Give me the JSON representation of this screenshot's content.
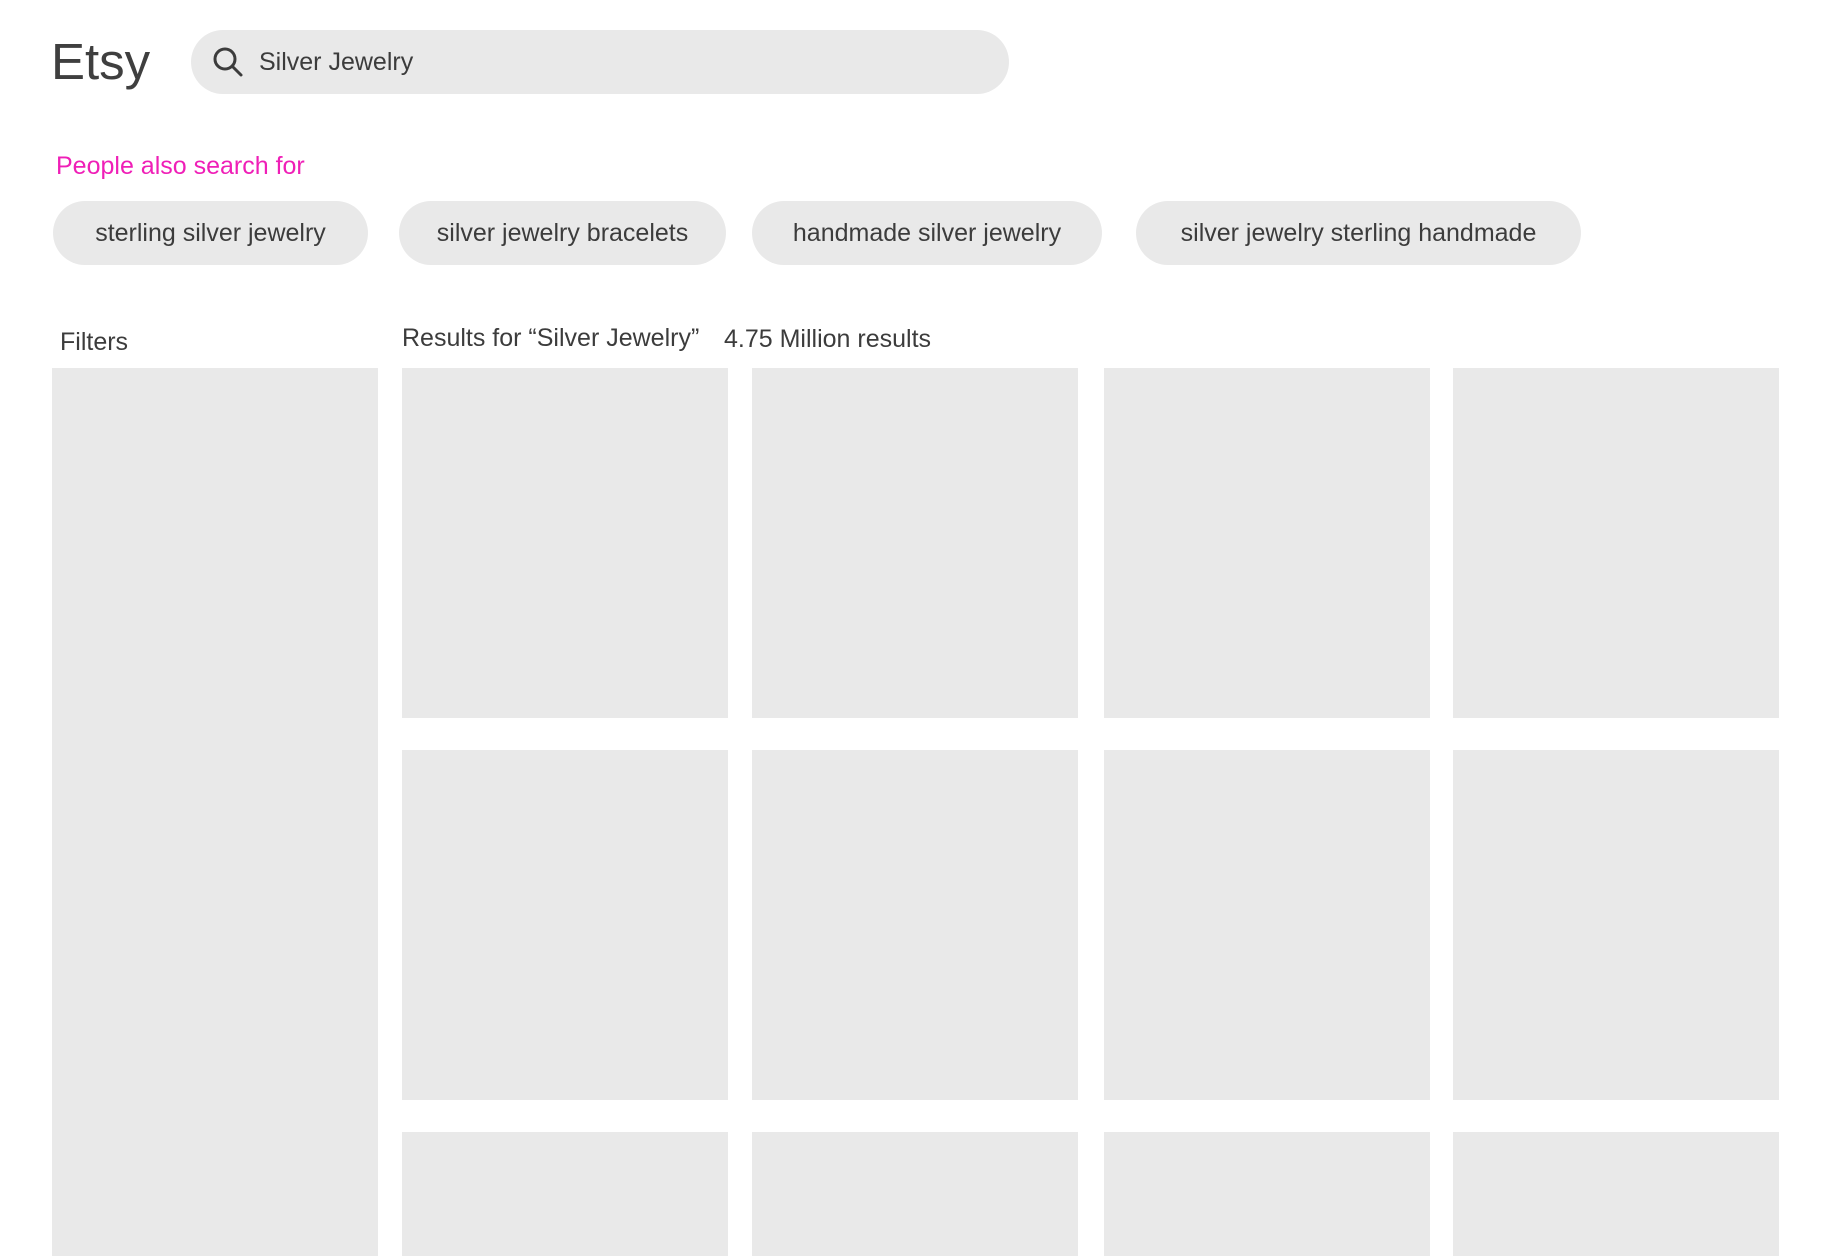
{
  "header": {
    "logo": "Etsy",
    "search": {
      "value": "Silver Jewelry",
      "icon": "search-icon"
    }
  },
  "related": {
    "title": "People also search for",
    "chips": [
      "sterling silver jewelry",
      "silver jewelry bracelets",
      "handmade silver jewelry",
      "silver jewelry sterling handmade"
    ]
  },
  "filters": {
    "label": "Filters"
  },
  "results": {
    "heading": "Results for “Silver Jewelry”",
    "count": "4.75 Million results",
    "listings": 12
  },
  "colors": {
    "accent": "#ef1fb7",
    "placeholder": "#e9e9e9",
    "text": "#3c3c3c"
  }
}
